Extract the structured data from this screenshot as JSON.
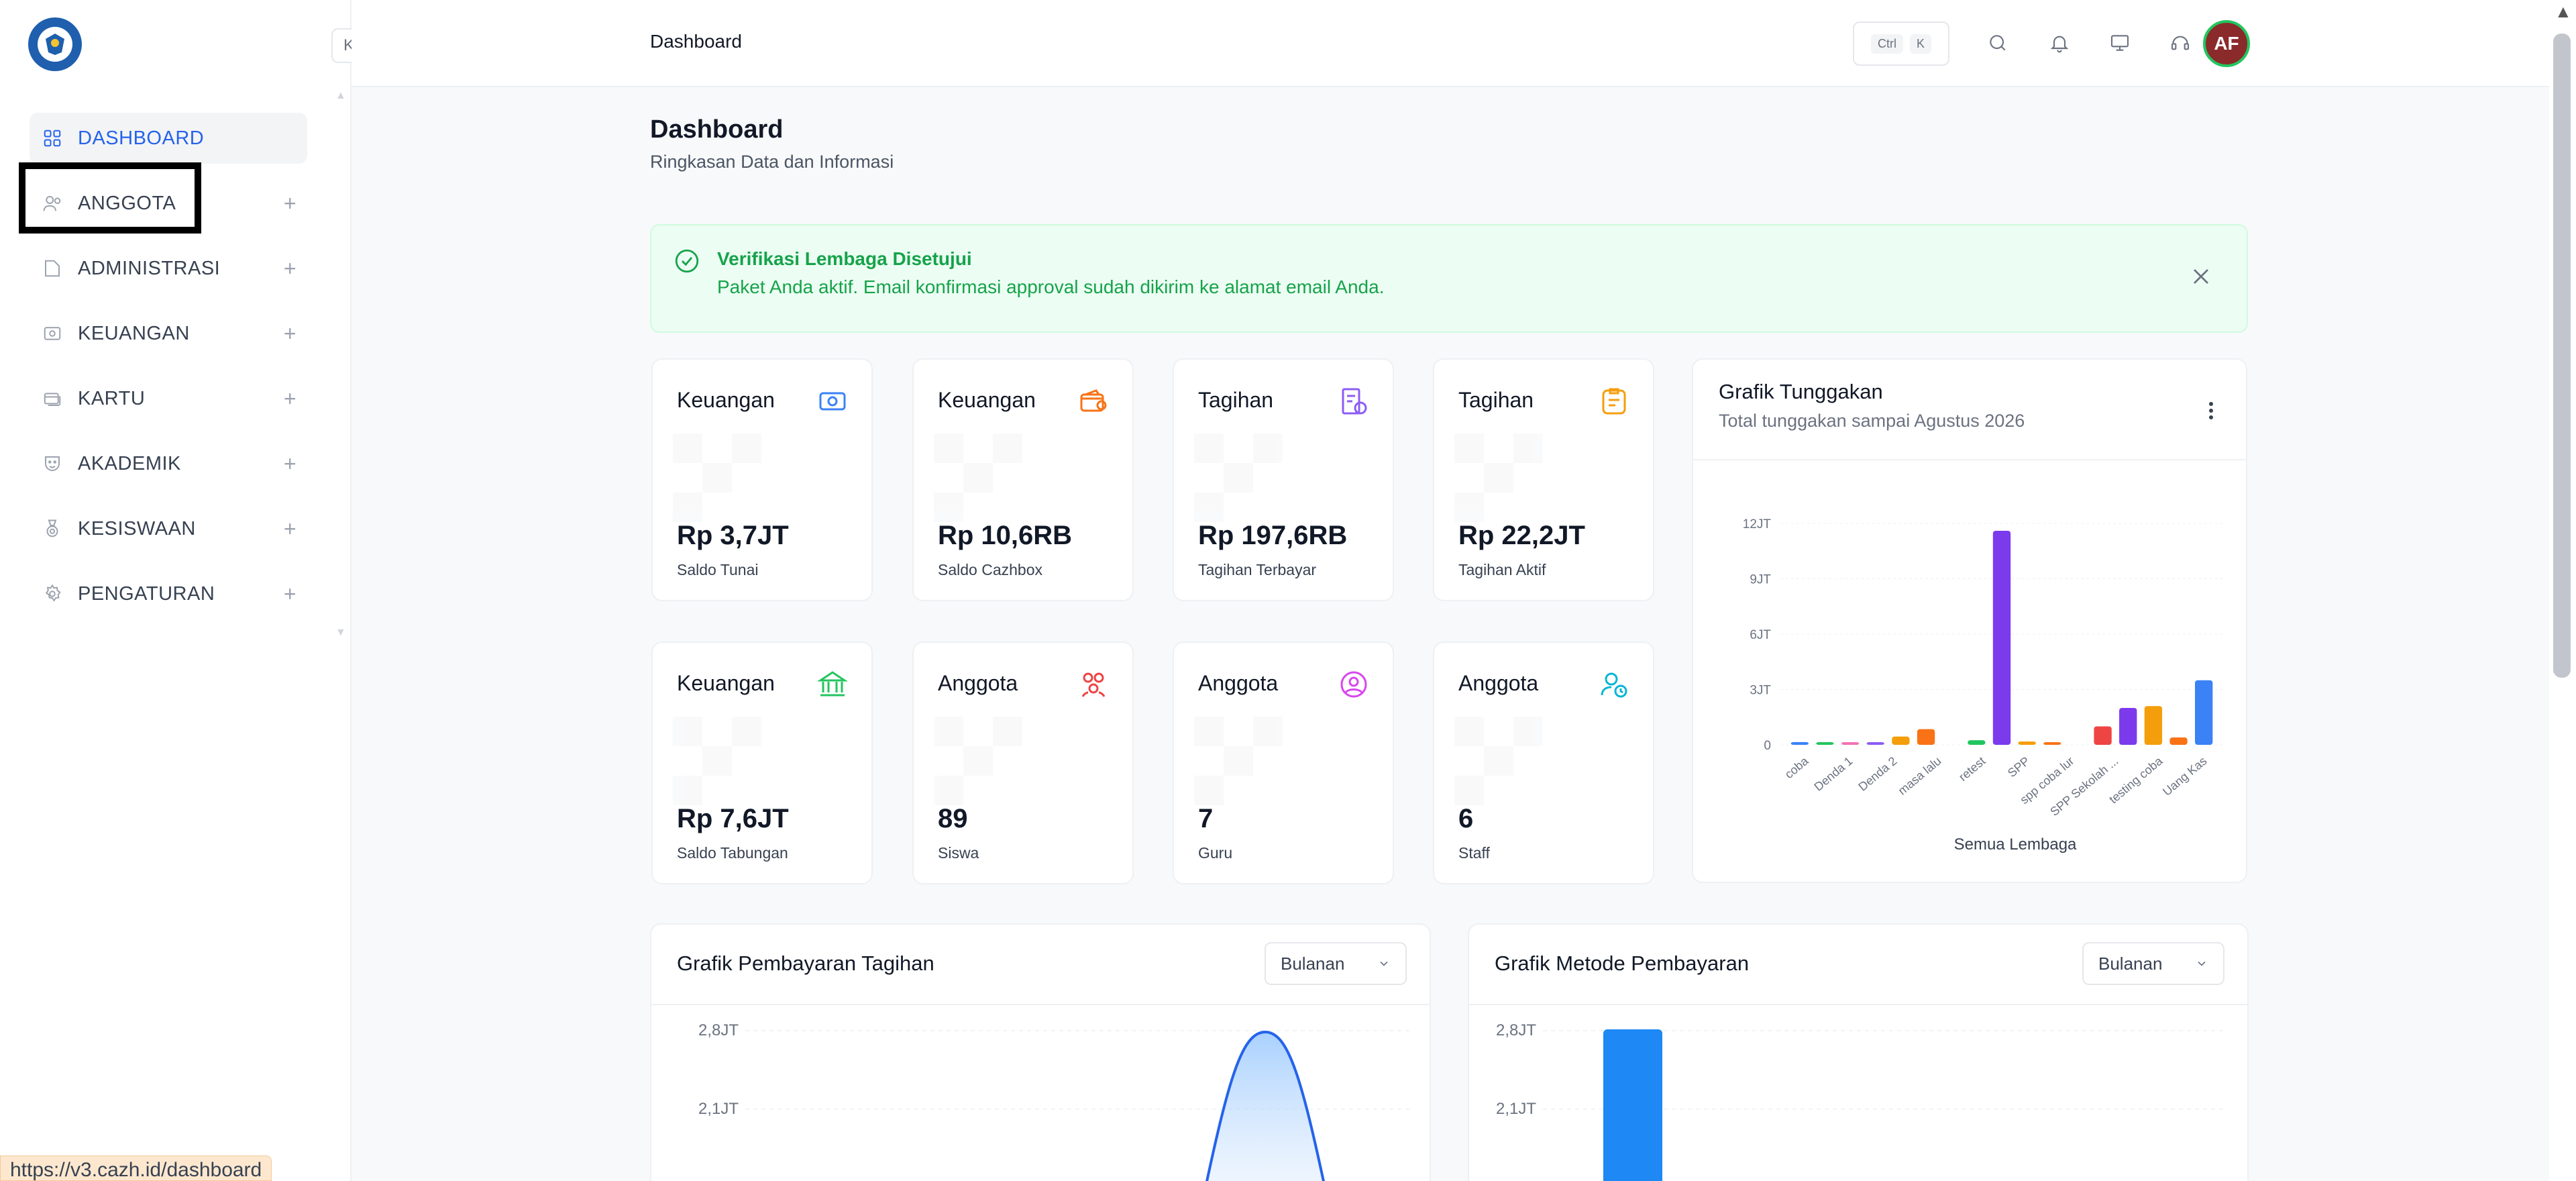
{
  "sidebar": {
    "items": [
      {
        "label": "DASHBOARD",
        "icon": "grid-icon",
        "active": true
      },
      {
        "label": "ANGGOTA",
        "icon": "users-icon"
      },
      {
        "label": "ADMINISTRASI",
        "icon": "folder-icon"
      },
      {
        "label": "KEUANGAN",
        "icon": "money-icon"
      },
      {
        "label": "KARTU",
        "icon": "card-icon"
      },
      {
        "label": "AKADEMIK",
        "icon": "mask-icon"
      },
      {
        "label": "KESISWAAN",
        "icon": "medal-icon"
      },
      {
        "label": "PENGATURAN",
        "icon": "gear-icon"
      }
    ],
    "plus": "+",
    "collapse": "K",
    "status_url": "https://v3.cazh.id/dashboard"
  },
  "header": {
    "breadcrumb": "Dashboard",
    "shortcut_keys": [
      "Ctrl",
      "K"
    ],
    "avatar_initials": "AF"
  },
  "page": {
    "title": "Dashboard",
    "subtitle": "Ringkasan Data dan Informasi"
  },
  "alert": {
    "title": "Verifikasi Lembaga Disetujui",
    "message": "Paket Anda aktif. Email konfirmasi approval sudah dikirim ke alamat email Anda."
  },
  "stats": [
    {
      "title": "Keuangan",
      "value": "Rp 3,7JT",
      "label": "Saldo Tunai",
      "icon": "wallet-icon",
      "color": "#3b82f6"
    },
    {
      "title": "Keuangan",
      "value": "Rp 10,6RB",
      "label": "Saldo Cazhbox",
      "icon": "purse-icon",
      "color": "#f97316"
    },
    {
      "title": "Tagihan",
      "value": "Rp 197,6RB",
      "label": "Tagihan Terbayar",
      "icon": "invoice-paid-icon",
      "color": "#8b5cf6"
    },
    {
      "title": "Tagihan",
      "value": "Rp 22,2JT",
      "label": "Tagihan Aktif",
      "icon": "invoice-active-icon",
      "color": "#f59e0b"
    },
    {
      "title": "Keuangan",
      "value": "Rp 7,6JT",
      "label": "Saldo Tabungan",
      "icon": "bank-icon",
      "color": "#22c55e"
    },
    {
      "title": "Anggota",
      "value": "89",
      "label": "Siswa",
      "icon": "students-icon",
      "color": "#ef4444"
    },
    {
      "title": "Anggota",
      "value": "7",
      "label": "Guru",
      "icon": "teacher-icon",
      "color": "#d946ef"
    },
    {
      "title": "Anggota",
      "value": "6",
      "label": "Staff",
      "icon": "staff-icon",
      "color": "#06b6d4"
    }
  ],
  "tunggakan": {
    "title": "Grafik Tunggakan",
    "subtitle": "Total tunggakan sampai Agustus 2026",
    "xlabel": "Semua Lembaga"
  },
  "pembayaran": {
    "title": "Grafik Pembayaran Tagihan",
    "select": "Bulanan",
    "yticks": [
      "2,8JT",
      "2,1JT"
    ]
  },
  "metode": {
    "title": "Grafik Metode Pembayaran",
    "select": "Bulanan",
    "yticks": [
      "2,8JT",
      "2,1JT"
    ]
  },
  "chart_data": [
    {
      "type": "bar",
      "title": "Grafik Tunggakan",
      "xlabel": "Semua Lembaga",
      "yticks": [
        "0",
        "3JT",
        "6JT",
        "9JT",
        "12JT"
      ],
      "ylim": [
        0,
        12000000
      ],
      "categories": [
        "coba",
        "Denda 1",
        "Denda 2",
        "masa lalu",
        "retest",
        "SPP",
        "spp coba lur",
        "SPP Sekolah ...",
        "testing coba",
        "Uang Kas"
      ],
      "series": [
        {
          "values": [
            150000,
            50000,
            100000,
            80000,
            450000,
            850000,
            0,
            250000,
            11600000,
            180000,
            80000,
            0,
            1000000,
            2000000,
            2100000,
            400000,
            3500000
          ]
        }
      ],
      "colors": [
        "#3b82f6",
        "#22c55e",
        "#f472b6",
        "#8b5cf6",
        "#f59e0b",
        "#f97316",
        "#22c55e",
        "#22c55e",
        "#7c3aed",
        "#f59e0b",
        "#f97316",
        "#22c55e",
        "#ef4444",
        "#7c3aed",
        "#f59e0b",
        "#f97316",
        "#3b82f6"
      ],
      "grid": true
    }
  ]
}
